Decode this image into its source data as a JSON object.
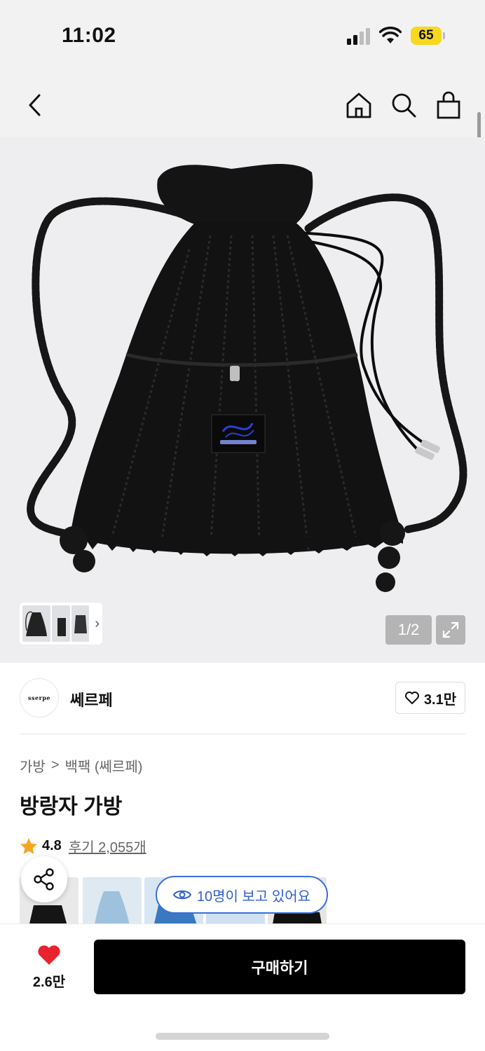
{
  "status_bar": {
    "time": "11:02",
    "battery": "65",
    "battery_color": "#f7d81f"
  },
  "nav": {
    "icons": [
      "chevron-left-icon",
      "home-icon",
      "search-icon",
      "shopping-bag-icon"
    ]
  },
  "gallery": {
    "counter": "1/2",
    "thumb_chevron": "›"
  },
  "brand": {
    "logo_text": "sserpe",
    "name": "쎄르페",
    "like_count": "3.1만"
  },
  "breadcrumb": {
    "category": "가방",
    "separator": ">",
    "subcategory": "백팩 (쎄르페)"
  },
  "product": {
    "title": "방랑자 가방"
  },
  "rating": {
    "value": "4.8",
    "reviews_label": "후기 2,055개",
    "star_color": "#f5a623"
  },
  "viewers": {
    "text": "10명이 보고 있어요",
    "accent": "#2f5fcf"
  },
  "bottom": {
    "wish_count": "2.6만",
    "buy_label": "구매하기",
    "heart_color": "#e8232f"
  }
}
